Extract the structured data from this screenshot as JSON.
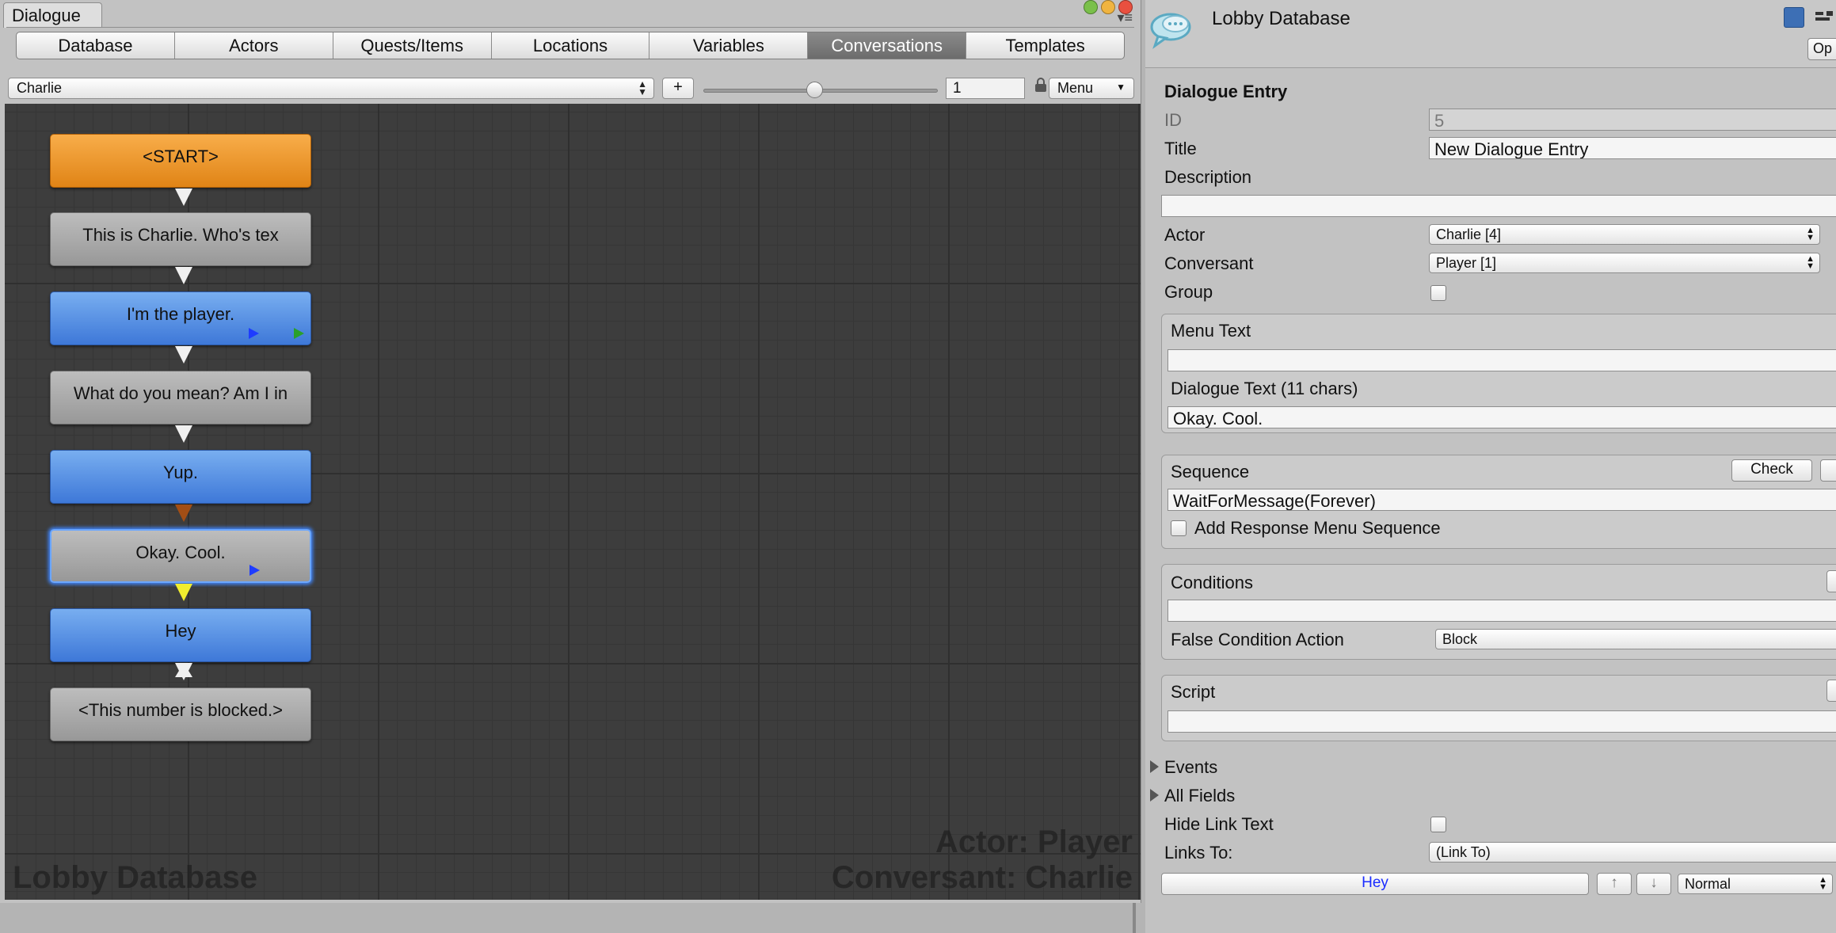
{
  "window": {
    "tab_label": "Dialogue",
    "menu_glyph": "▾≡"
  },
  "tabs": [
    {
      "label": "Database"
    },
    {
      "label": "Actors"
    },
    {
      "label": "Quests/Items"
    },
    {
      "label": "Locations"
    },
    {
      "label": "Variables"
    },
    {
      "label": "Conversations",
      "active": true
    },
    {
      "label": "Templates"
    }
  ],
  "toolbar": {
    "conversation": "Charlie",
    "add_label": "+",
    "zoom_value": "1",
    "menu_label": "Menu"
  },
  "nodes": [
    {
      "text": "<START>",
      "kind": "start"
    },
    {
      "text": "This is Charlie. Who's tex",
      "kind": "npc"
    },
    {
      "text": "I'm the player.",
      "kind": "pc"
    },
    {
      "text": "What do you mean? Am I in",
      "kind": "npc"
    },
    {
      "text": "Yup.",
      "kind": "pc"
    },
    {
      "text": "Okay. Cool.",
      "kind": "npc",
      "selected": true
    },
    {
      "text": "Hey",
      "kind": "pc"
    },
    {
      "text": "<This number is blocked.>",
      "kind": "npc"
    }
  ],
  "watermarks": {
    "database": "Lobby Database",
    "actor": "Actor: Player",
    "conversant": "Conversant: Charlie"
  },
  "inspector": {
    "title": "Lobby Database",
    "open_label": "Op",
    "section": "Dialogue Entry",
    "id_label": "ID",
    "id_value": "5",
    "title_label": "Title",
    "title_value": "New Dialogue Entry",
    "description_label": "Description",
    "description_value": "",
    "actor_label": "Actor",
    "actor_value": "Charlie [4]",
    "conversant_label": "Conversant",
    "conversant_value": "Player [1]",
    "group_label": "Group",
    "menu_text_label": "Menu Text",
    "menu_text_value": "",
    "dialogue_text_label": "Dialogue Text (11 chars)",
    "dialogue_text_value": "Okay. Cool.",
    "sequence_label": "Sequence",
    "check_label": "Check",
    "sequence_value": "WaitForMessage(Forever)",
    "add_response_label": "Add Response Menu Sequence",
    "conditions_label": "Conditions",
    "conditions_value": "",
    "false_action_label": "False Condition Action",
    "false_action_value": "Block",
    "script_label": "Script",
    "script_value": "",
    "events_label": "Events",
    "all_fields_label": "All Fields",
    "hide_link_label": "Hide Link Text",
    "links_to_label": "Links To:",
    "links_to_value": "(Link To)",
    "link_target": "Hey",
    "link_up": "↑",
    "link_down": "↓",
    "link_priority": "Normal"
  },
  "colors": {
    "start_node": "#e8911f",
    "player_node": "#4f8be3",
    "npc_node": "#a9a9a9",
    "selected_glow": "#3f86ff",
    "link_text": "#1a2cff"
  }
}
